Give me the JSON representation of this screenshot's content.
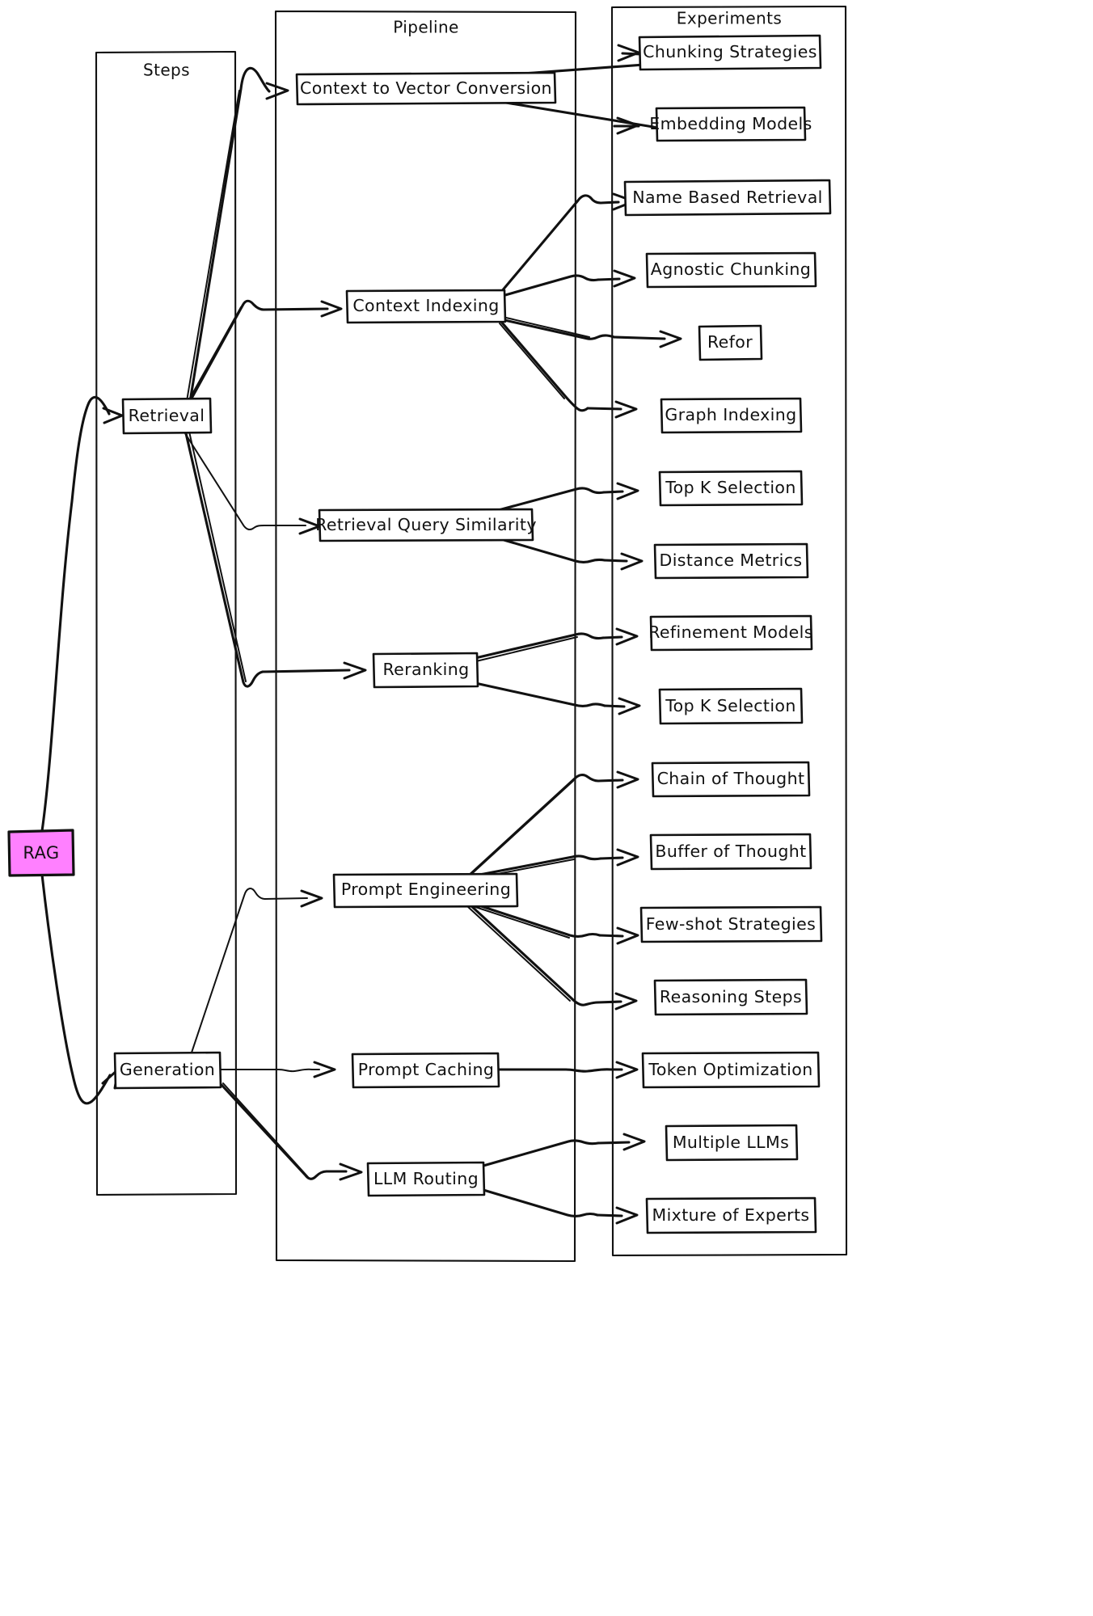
{
  "diagram": {
    "title": "RAG Pipeline Experiments Flowchart",
    "style": "hand-drawn",
    "root": {
      "label": "RAG",
      "color": "#ff80ff"
    },
    "clusters": [
      {
        "id": "steps",
        "label": "Steps"
      },
      {
        "id": "pipeline",
        "label": "Pipeline"
      },
      {
        "id": "experiments",
        "label": "Experiments"
      }
    ],
    "steps": [
      {
        "id": "retrieval",
        "label": "Retrieval"
      },
      {
        "id": "generation",
        "label": "Generation"
      }
    ],
    "pipeline": [
      {
        "id": "ctv",
        "label": "Context to Vector Conversion"
      },
      {
        "id": "ci",
        "label": "Context Indexing"
      },
      {
        "id": "rqs",
        "label": "Retrieval Query Similarity"
      },
      {
        "id": "rr",
        "label": "Reranking"
      },
      {
        "id": "pe",
        "label": "Prompt Engineering"
      },
      {
        "id": "pc",
        "label": "Prompt Caching"
      },
      {
        "id": "lr",
        "label": "LLM Routing"
      }
    ],
    "experiments": [
      {
        "id": "cs",
        "label": "Chunking Strategies"
      },
      {
        "id": "em",
        "label": "Embedding Models"
      },
      {
        "id": "nbr",
        "label": "Name Based Retrieval"
      },
      {
        "id": "ac",
        "label": "Agnostic Chunking"
      },
      {
        "id": "refor",
        "label": "Refor"
      },
      {
        "id": "gi",
        "label": "Graph Indexing"
      },
      {
        "id": "tks1",
        "label": "Top K Selection"
      },
      {
        "id": "dm",
        "label": "Distance Metrics"
      },
      {
        "id": "rm",
        "label": "Refinement Models"
      },
      {
        "id": "tks2",
        "label": "Top K Selection"
      },
      {
        "id": "cot",
        "label": "Chain of Thought"
      },
      {
        "id": "bot",
        "label": "Buffer of Thought"
      },
      {
        "id": "fss",
        "label": "Few-shot Strategies"
      },
      {
        "id": "rs",
        "label": "Reasoning Steps"
      },
      {
        "id": "to",
        "label": "Token Optimization"
      },
      {
        "id": "ml",
        "label": "Multiple LLMs"
      },
      {
        "id": "moe",
        "label": "Mixture of Experts"
      }
    ],
    "edges": [
      {
        "from": "RAG",
        "to": "Retrieval"
      },
      {
        "from": "RAG",
        "to": "Generation"
      },
      {
        "from": "Retrieval",
        "to": "Context to Vector Conversion"
      },
      {
        "from": "Retrieval",
        "to": "Context Indexing"
      },
      {
        "from": "Retrieval",
        "to": "Retrieval Query Similarity"
      },
      {
        "from": "Retrieval",
        "to": "Reranking"
      },
      {
        "from": "Generation",
        "to": "Prompt Engineering"
      },
      {
        "from": "Generation",
        "to": "Prompt Caching"
      },
      {
        "from": "Generation",
        "to": "LLM Routing"
      },
      {
        "from": "Context to Vector Conversion",
        "to": "Chunking Strategies"
      },
      {
        "from": "Context to Vector Conversion",
        "to": "Embedding Models"
      },
      {
        "from": "Context Indexing",
        "to": "Name Based Retrieval"
      },
      {
        "from": "Context Indexing",
        "to": "Agnostic Chunking"
      },
      {
        "from": "Context Indexing",
        "to": "Refor"
      },
      {
        "from": "Context Indexing",
        "to": "Graph Indexing"
      },
      {
        "from": "Retrieval Query Similarity",
        "to": "Top K Selection"
      },
      {
        "from": "Retrieval Query Similarity",
        "to": "Distance Metrics"
      },
      {
        "from": "Reranking",
        "to": "Refinement Models"
      },
      {
        "from": "Reranking",
        "to": "Top K Selection"
      },
      {
        "from": "Prompt Engineering",
        "to": "Chain of Thought"
      },
      {
        "from": "Prompt Engineering",
        "to": "Buffer of Thought"
      },
      {
        "from": "Prompt Engineering",
        "to": "Few-shot Strategies"
      },
      {
        "from": "Prompt Engineering",
        "to": "Reasoning Steps"
      },
      {
        "from": "Prompt Caching",
        "to": "Token Optimization"
      },
      {
        "from": "LLM Routing",
        "to": "Multiple LLMs"
      },
      {
        "from": "LLM Routing",
        "to": "Mixture of Experts"
      }
    ]
  }
}
